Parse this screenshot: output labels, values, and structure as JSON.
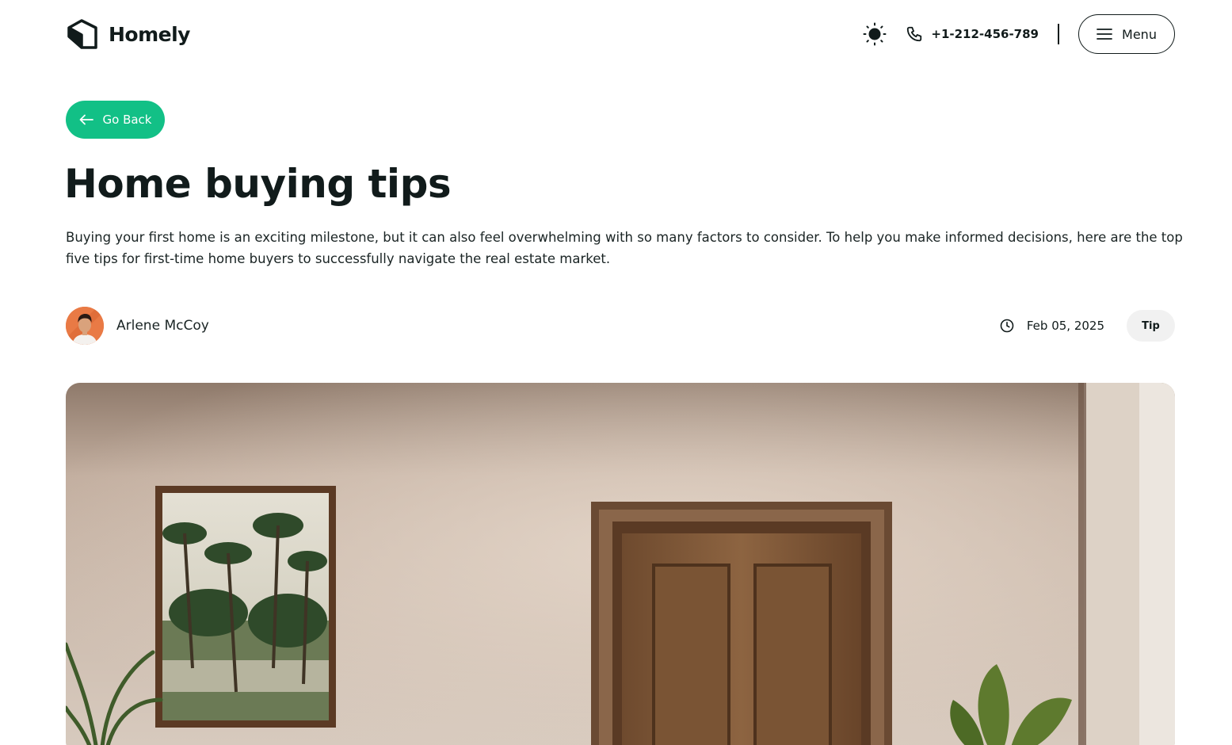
{
  "brand": {
    "name": "Homely",
    "logo_icon": "house-icon"
  },
  "header": {
    "theme_icon": "sun-icon",
    "phone": "+1-212-456-789",
    "phone_icon": "phone-icon",
    "menu_label": "Menu",
    "menu_icon": "hamburger-icon"
  },
  "back_button": {
    "label": "Go Back",
    "icon": "arrow-left-icon"
  },
  "article": {
    "title": "Home buying tips",
    "intro": "Buying your first home is an exciting milestone, but it can also feel overwhelming with so many factors to consider. To help you make informed decisions, here are the top five tips for first-time home buyers to successfully navigate the real estate market.",
    "author": "Arlene McCoy",
    "date": "Feb 05, 2025",
    "date_icon": "clock-icon",
    "tag": "Tip"
  },
  "colors": {
    "accent": "#12c086",
    "text": "#111b1b",
    "tag_bg": "#f1f1f1"
  }
}
